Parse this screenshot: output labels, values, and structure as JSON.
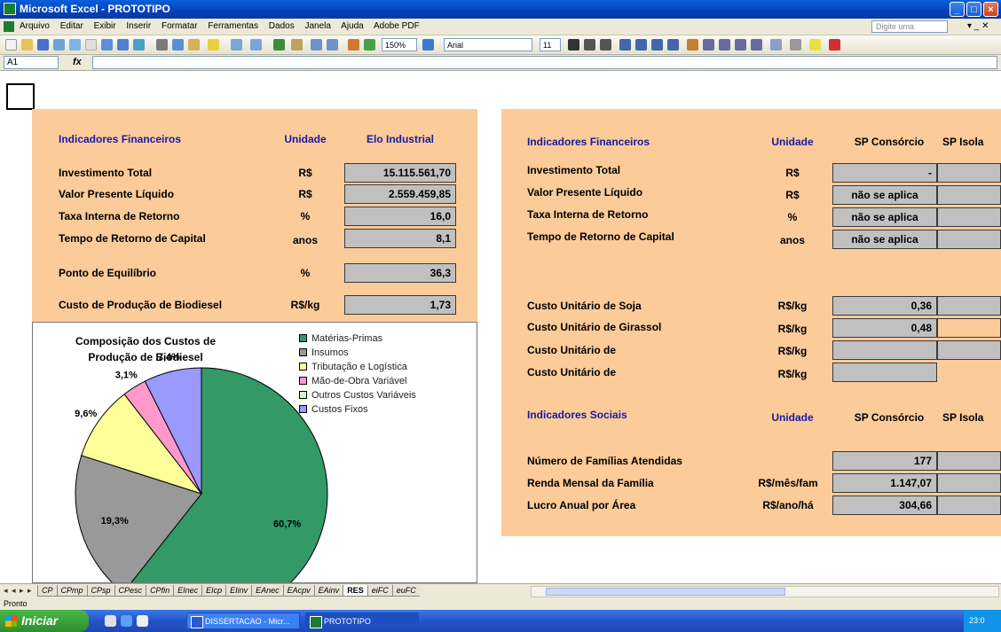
{
  "window": {
    "title": "Microsoft Excel - PROTOTIPO",
    "min": "_",
    "max": "□",
    "close": "×"
  },
  "menu": {
    "items": [
      "Arquivo",
      "Editar",
      "Exibir",
      "Inserir",
      "Formatar",
      "Ferramentas",
      "Dados",
      "Janela",
      "Ajuda",
      "Adobe PDF"
    ],
    "ask_placeholder": "Digite uma pergunta",
    "mdi_controls": "▾ _ ✕"
  },
  "toolbar": {
    "zoom": "150%",
    "font": "Arial",
    "font_size": "11"
  },
  "formula_bar": {
    "name_box": "A1",
    "fx": "fx",
    "content": ""
  },
  "left_panel": {
    "header": {
      "label": "Indicadores Financeiros",
      "unit": "Unidade",
      "col": "Elo Industrial"
    },
    "rows": [
      {
        "label": "Investimento Total",
        "unit": "R$",
        "value": "15.115.561,70"
      },
      {
        "label": "Valor Presente Líquido",
        "unit": "R$",
        "value": "2.559.459,85"
      },
      {
        "label": "Taxa Interna de Retorno",
        "unit": "%",
        "value": "16,0"
      },
      {
        "label": "Tempo de Retorno de Capital",
        "unit": "anos",
        "value": "8,1"
      },
      {
        "label": "Ponto de Equilíbrio",
        "unit": "%",
        "value": "36,3"
      },
      {
        "label": "Custo de Produção de Biodiesel",
        "unit": "R$/kg",
        "value": "1,73"
      }
    ]
  },
  "right_panel": {
    "financial_header": {
      "label": "Indicadores Financeiros",
      "unit": "Unidade",
      "col1": "SP Consórcio",
      "col2": "SP Isola"
    },
    "financial_rows": [
      {
        "label": "Investimento Total",
        "unit": "R$",
        "value": "-"
      },
      {
        "label": "Valor Presente Líquido",
        "unit": "R$",
        "value": "não se aplica"
      },
      {
        "label": "Taxa Interna de Retorno",
        "unit": "%",
        "value": "não se aplica"
      },
      {
        "label": "Tempo de Retorno de Capital",
        "unit": "anos",
        "value": "não se aplica"
      }
    ],
    "cost_rows": [
      {
        "label": "Custo Unitário de  Soja",
        "unit": "R$/kg",
        "value": "0,36"
      },
      {
        "label": "Custo Unitário de  Girassol",
        "unit": "R$/kg",
        "value": "0,48"
      },
      {
        "label": "Custo Unitário de",
        "unit": "R$/kg",
        "value": ""
      },
      {
        "label": "Custo Unitário de",
        "unit": "R$/kg",
        "value": ""
      }
    ],
    "social_header": {
      "label": "Indicadores Sociais",
      "unit": "Unidade",
      "col1": "SP Consórcio",
      "col2": "SP Isola"
    },
    "social_rows": [
      {
        "label": "Número de Famílias Atendidas",
        "unit": "",
        "value": "177"
      },
      {
        "label": "Renda Mensal da Família",
        "unit": "R$/mês/fam",
        "value": "1.147,07"
      },
      {
        "label": "Lucro Anual por Área",
        "unit": "R$/ano/há",
        "value": "304,66"
      }
    ]
  },
  "chart_data": {
    "type": "pie",
    "title_line1": "Composição dos Custos de",
    "title_line2": "Produção de Biodiesel",
    "legend_position": "top-right",
    "categories": [
      "Matérias-Primas",
      "Insumos",
      "Tributação e Logística",
      "Mão-de-Obra Variável",
      "Outros Custos Variáveis",
      "Custos Fixos"
    ],
    "values": [
      60.7,
      19.3,
      9.6,
      3.1,
      0.0,
      7.4
    ],
    "labels": [
      "60,7%",
      "19,3%",
      "9,6%",
      "3,1%",
      "",
      "7,4%"
    ],
    "colors": [
      "#339966",
      "#999999",
      "#ffff99",
      "#ff99cc",
      "#ccffcc",
      "#9999ff"
    ]
  },
  "sheet_tabs": {
    "nav": "◂ ◂ ▸ ▸",
    "tabs": [
      "CP",
      "CPmp",
      "CPsp",
      "CPesc",
      "CPfin",
      "EInec",
      "EIcp",
      "EIinv",
      "EAnec",
      "EAcpv",
      "EAinv",
      "RES",
      "eiFC",
      "euFC"
    ],
    "active": "RES"
  },
  "status": {
    "text": "Pronto"
  },
  "taskbar": {
    "start": "Iniciar",
    "items": [
      "DISSERTACAO - Micr...",
      "PROTOTIPO"
    ],
    "clock": "23:0"
  }
}
